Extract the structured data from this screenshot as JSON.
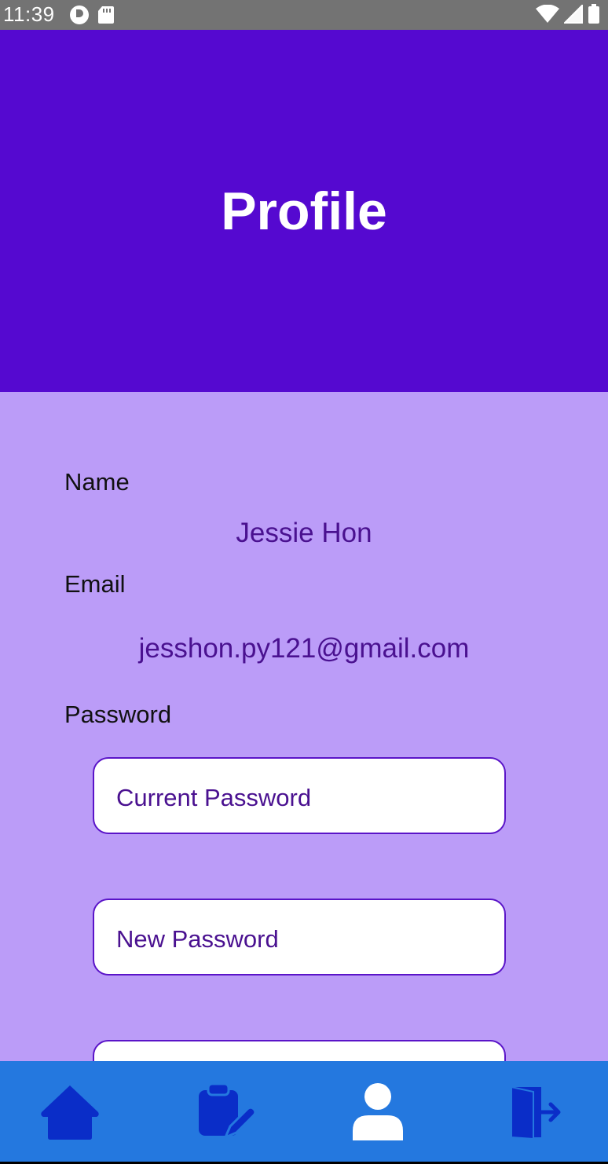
{
  "status_bar": {
    "time": "11:39"
  },
  "header": {
    "title": "Profile"
  },
  "profile": {
    "name_label": "Name",
    "name_value": "Jessie Hon",
    "email_label": "Email",
    "email_value": "jesshon.py121@gmail.com",
    "password_label": "Password",
    "current_password_placeholder": "Current Password",
    "new_password_placeholder": "New Password",
    "confirm_password_placeholder": ""
  },
  "bottom_nav": {
    "items": [
      {
        "icon": "home-icon",
        "active": false
      },
      {
        "icon": "edit-clipboard-icon",
        "active": false
      },
      {
        "icon": "profile-icon",
        "active": true
      },
      {
        "icon": "logout-icon",
        "active": false
      }
    ]
  },
  "colors": {
    "header_bg": "#5509d0",
    "content_bg": "#bb9cf8",
    "nav_bg": "#2478df",
    "nav_icon": "#0a2dc8",
    "nav_icon_active": "#ffffff",
    "value_text": "#4a1190"
  }
}
